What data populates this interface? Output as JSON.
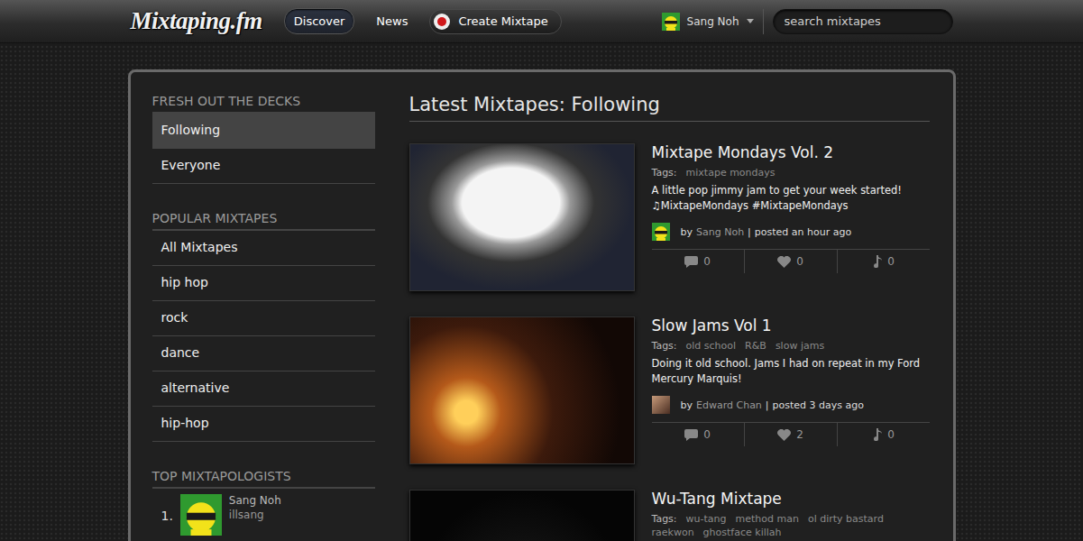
{
  "header": {
    "logo": "Mixtaping.fm",
    "nav": [
      {
        "label": "Discover",
        "selected": true
      },
      {
        "label": "News",
        "selected": false
      },
      {
        "label": "Create Mixtape",
        "selected": false,
        "kind": "record"
      }
    ],
    "user": {
      "name": "Sang Noh"
    },
    "search": {
      "placeholder": "search mixtapes"
    }
  },
  "sidebar": {
    "sections": [
      {
        "title": "FRESH OUT THE DECKS",
        "items": [
          {
            "label": "Following",
            "selected": true
          },
          {
            "label": "Everyone",
            "selected": false
          }
        ]
      },
      {
        "title": "POPULAR MIXTAPES",
        "items": [
          {
            "label": "All Mixtapes",
            "selected": false
          },
          {
            "label": "hip hop",
            "selected": false
          },
          {
            "label": "rock",
            "selected": false
          },
          {
            "label": "dance",
            "selected": false
          },
          {
            "label": "alternative",
            "selected": false
          },
          {
            "label": "hip-hop",
            "selected": false
          }
        ]
      }
    ],
    "top": {
      "title": "TOP MIXTAPOLOGISTS",
      "users": [
        {
          "rank": "1.",
          "name": "Sang Noh",
          "handle": "illsang"
        }
      ]
    }
  },
  "main": {
    "title": "Latest Mixtapes: Following",
    "tags_label": "Tags:",
    "by_label": "by",
    "separator": "|",
    "mixtapes": [
      {
        "title": "Mixtape Mondays Vol. 2",
        "tags": [
          "mixtape mondays"
        ],
        "description": "A little pop jimmy jam to get your week started! ♫MixtapeMondays #MixtapeMondays",
        "author": "Sang Noh",
        "posted": "posted an hour ago",
        "stats": {
          "comments": "0",
          "likes": "0",
          "plays": "0"
        }
      },
      {
        "title": "Slow Jams Vol 1",
        "tags": [
          "old school",
          "R&B",
          "slow jams"
        ],
        "description": "Doing it old school. Jams I had on repeat in my Ford Mercury Marquis!",
        "author": "Edward Chan",
        "posted": "posted 3 days ago",
        "stats": {
          "comments": "0",
          "likes": "2",
          "plays": "0"
        }
      },
      {
        "title": "Wu-Tang Mixtape",
        "tags": [
          "wu-tang",
          "method man",
          "ol dirty bastard",
          "raekwon",
          "ghostface killah"
        ]
      }
    ]
  }
}
